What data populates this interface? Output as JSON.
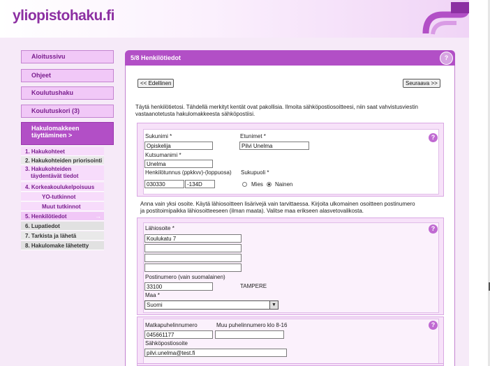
{
  "header": {
    "logo": "yliopistohaku.fi"
  },
  "sidebar": {
    "main_items": [
      {
        "label": "Aloitussivu"
      },
      {
        "label": "Ohjeet"
      },
      {
        "label": "Koulutushaku"
      },
      {
        "label": "Koulutuskori (3)"
      }
    ],
    "active": {
      "line1": "Hakulomakkeen",
      "line2": "täyttäminen >"
    },
    "steps": [
      {
        "label": "1. Hakukohteet"
      },
      {
        "label": "2. Hakukohteiden priorisointi"
      },
      {
        "label": "3. Hakukohteiden"
      },
      {
        "label": "täydentävät tiedot"
      },
      {
        "label": "4. Korkeakoulukelpoisuus"
      },
      {
        "label": "YO-tutkinnot"
      },
      {
        "label": "Muut tutkinnot"
      },
      {
        "label": "5. Henkilötiedot"
      },
      {
        "label": "6. Lupatiedot"
      },
      {
        "label": "7. Tarkista ja lähetä"
      },
      {
        "label": "8. Hakulomake lähetetty"
      }
    ],
    "current_arrow": "→"
  },
  "panel": {
    "title": "5/8 Henkilötiedot",
    "help": "?",
    "prev_button": "<< Edellinen",
    "next_button": "Seuraava >>",
    "intro_line1": "Täytä henkilötietosi. Tähdellä merkityt kentät ovat pakollisia. Ilmoita sähköpostiosoitteesi, niin saat vahvistusviestin",
    "intro_line2": "vastaanotetusta hakulomakkeesta sähköpostiisi."
  },
  "person": {
    "surname_label": "Sukunimi *",
    "surname_value": "Opiskelija",
    "firstnames_label": "Etunimet *",
    "firstnames_value": "Pilvi Unelma",
    "nickname_label": "Kutsumanimi *",
    "nickname_value": "Unelma",
    "ssn_label": "Henkilötunnus (ppkkvv)-(loppuosa)",
    "ssn_value1": "030330",
    "ssn_value2": "-134D",
    "gender_label": "Sukupuoli *",
    "male_label": "Mies",
    "female_label": "Nainen",
    "help": "?"
  },
  "address_info": {
    "line1": "Anna vain yksi osoite. Käytä lähiosoitteen lisärivejä vain tarvittaessa. Kirjoita ulkomainen osoitteen postinumero",
    "line2": "ja postitoimipaikka lähiosoitteeseen (ilman maata). Valitse maa erikseen alasvetovalikosta."
  },
  "address": {
    "street_label": "Lähiosoite *",
    "street_value": "Koulukatu 7",
    "postcode_label": "Postinumero (vain suomalainen)",
    "postcode_value": "33100",
    "city": "TAMPERE",
    "country_label": "Maa *",
    "country_value": "Suomi",
    "select_arrow": "▼",
    "help": "?"
  },
  "contact": {
    "mobile_label": "Matkapuhelinnumero",
    "mobile_value": "045661177",
    "other_label": "Muu puhelinnumero klo 8-16",
    "other_value": "",
    "email_label": "Sähköpostiosoite",
    "email_value": "pilvi.unelma@test.fi",
    "help": "?"
  }
}
